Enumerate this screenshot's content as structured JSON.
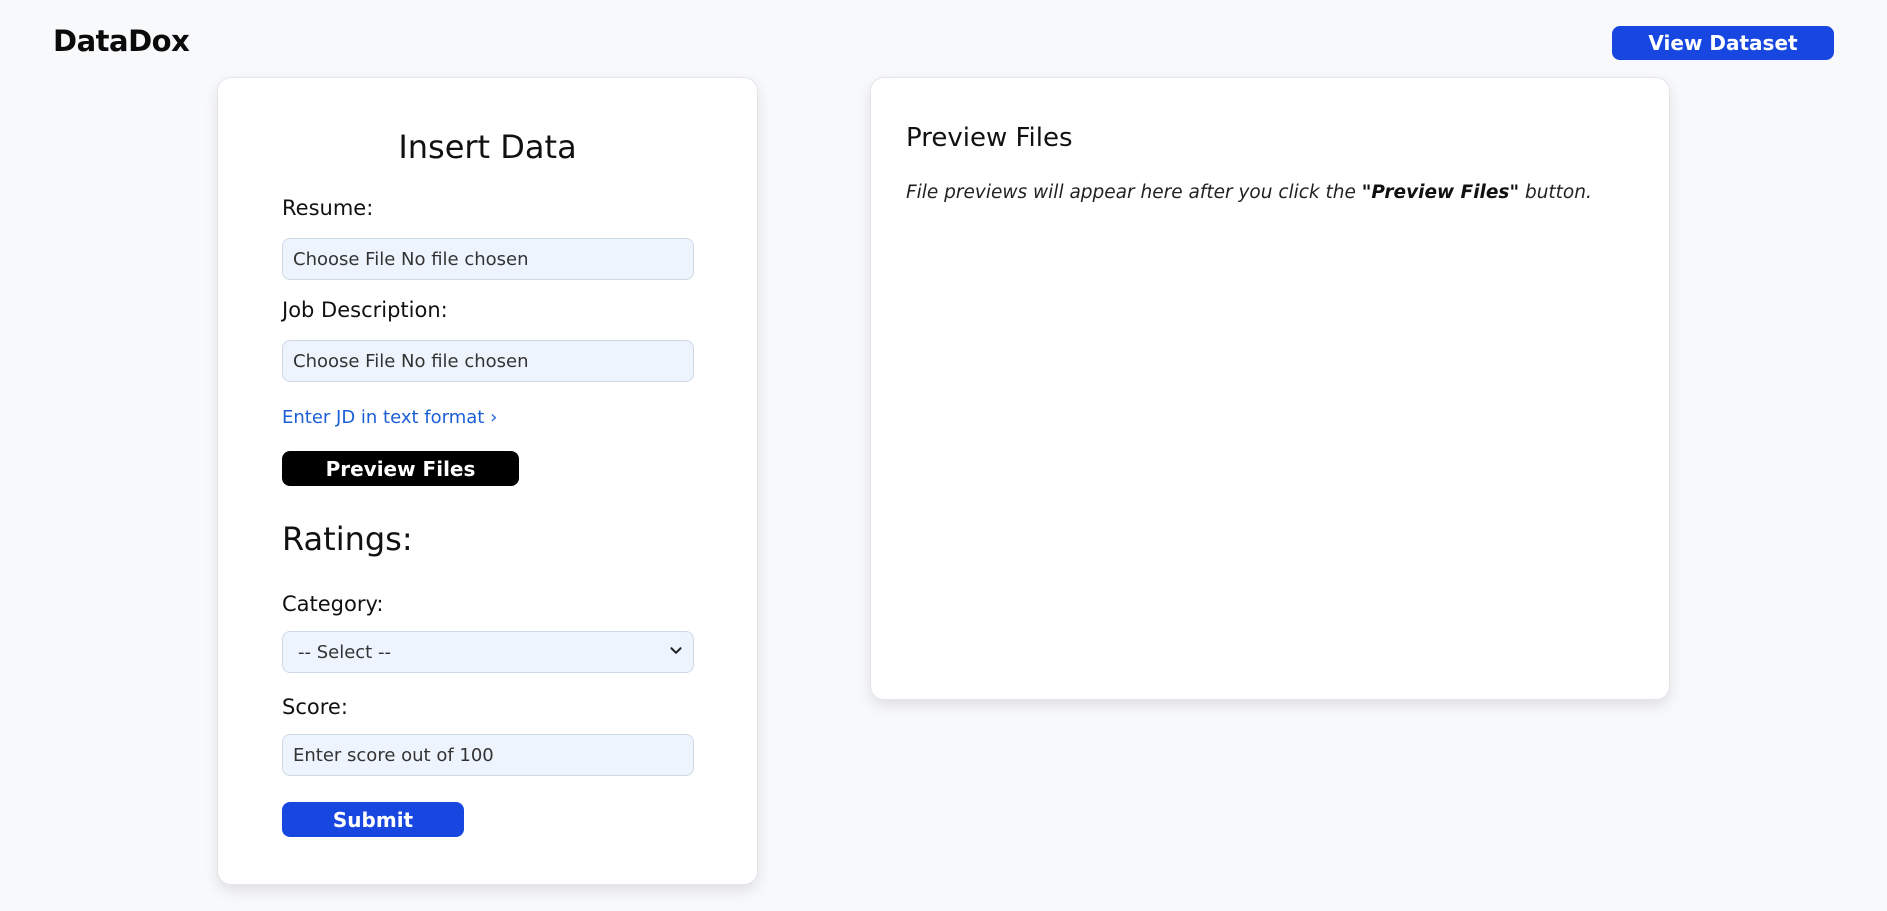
{
  "app": {
    "brand": "DataDox",
    "view_dataset_label": "View Dataset"
  },
  "insert": {
    "title": "Insert Data",
    "resume_label": "Resume:",
    "resume_file_text": "Choose File No file chosen",
    "jd_label": "Job Description:",
    "jd_file_text": "Choose File No file chosen",
    "jd_text_link": "Enter JD in text format ›",
    "preview_button": "Preview Files",
    "ratings_heading": "Ratings:",
    "category_label": "Category:",
    "category_selected": "-- Select --",
    "score_label": "Score:",
    "score_placeholder": "Enter score out of 100",
    "submit_label": "Submit"
  },
  "preview": {
    "title": "Preview Files",
    "message_before": "File previews will appear here after you click the ",
    "message_emphasis": "\"Preview Files\"",
    "message_after": " button."
  },
  "colors": {
    "accent": "#1747e0",
    "link": "#1a5fd6",
    "field_bg": "#eef4fd",
    "page_bg": "#f8f9fb"
  },
  "icons": {
    "select_caret": "chevron-down-icon"
  }
}
